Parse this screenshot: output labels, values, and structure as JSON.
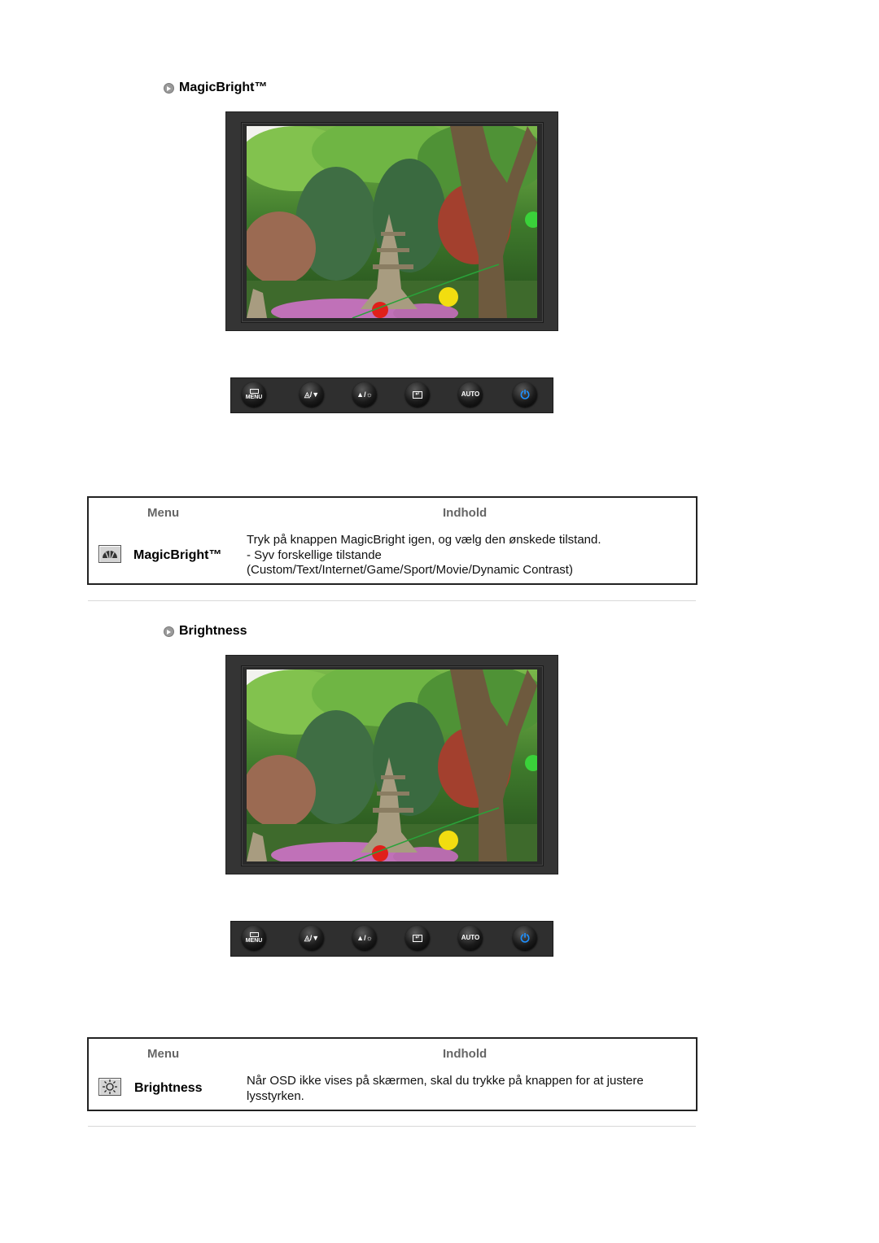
{
  "sections": [
    {
      "heading": "MagicBright™",
      "buttons": [
        {
          "icon": "menu-icon",
          "label": "MENU"
        },
        {
          "icon": "magicbright-down-icon",
          "label": ""
        },
        {
          "icon": "brightness-up-icon",
          "label": ""
        },
        {
          "icon": "enter-icon",
          "label": ""
        },
        {
          "icon": "auto-icon",
          "label": "AUTO"
        },
        {
          "icon": "power-icon",
          "label": ""
        }
      ],
      "table": {
        "col_menu": "Menu",
        "col_content": "Indhold",
        "row_icon": "magicbright-icon",
        "row_name": "MagicBright™",
        "content_lines": [
          "Tryk på knappen MagicBright igen, og vælg den ønskede tilstand.",
          "- Syv forskellige tilstande",
          "(Custom/Text/Internet/Game/Sport/Movie/Dynamic Contrast)"
        ]
      }
    },
    {
      "heading": "Brightness",
      "buttons": [
        {
          "icon": "menu-icon",
          "label": "MENU"
        },
        {
          "icon": "magicbright-down-icon",
          "label": ""
        },
        {
          "icon": "brightness-up-icon",
          "label": ""
        },
        {
          "icon": "enter-icon",
          "label": ""
        },
        {
          "icon": "auto-icon",
          "label": "AUTO"
        },
        {
          "icon": "power-icon",
          "label": ""
        }
      ],
      "table": {
        "col_menu": "Menu",
        "col_content": "Indhold",
        "row_icon": "brightness-icon",
        "row_name": "Brightness",
        "content_lines": [
          "Når OSD ikke vises på skærmen, skal du trykke på knappen for at justere",
          "lysstyrken."
        ]
      }
    }
  ],
  "colors": {
    "header_text": "#666666",
    "bezel": "#343434",
    "power_accent": "#1e90ff"
  }
}
